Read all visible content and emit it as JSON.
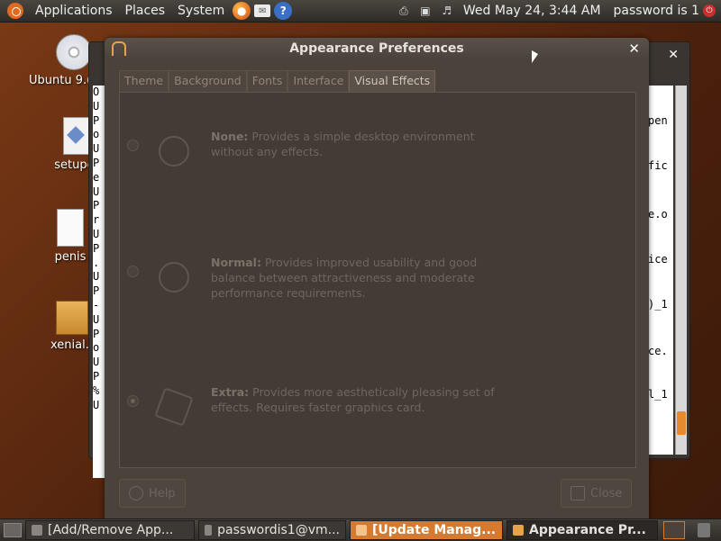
{
  "top_panel": {
    "menus": [
      "Applications",
      "Places",
      "System"
    ],
    "launchers": [
      "firefox-icon",
      "mail-icon",
      "help-icon"
    ],
    "clock": "Wed May 24,  3:44 AM",
    "user": "password is 1"
  },
  "desktop_icons": [
    {
      "label": "Ubuntu 9.(",
      "icon": "cd-icon"
    },
    {
      "label": "setupce",
      "icon": "script-icon"
    },
    {
      "label": "penis",
      "icon": "text-file-icon"
    },
    {
      "label": "xenial.t",
      "icon": "archive-icon"
    }
  ],
  "terminal": {
    "left_text": "O\nU\nP\no\nU\nP\ne\nU\nP\nr\nU\nP\n.\nU\nP\n-\nU\nP\no\nU\nP\n%\nU",
    "right_fragments": [
      "pen",
      "fic",
      "e.o",
      "ice",
      ")_1",
      "ce.",
      "l_1"
    ]
  },
  "dialog": {
    "title": "Appearance Preferences",
    "tabs": [
      "Theme",
      "Background",
      "Fonts",
      "Interface",
      "Visual Effects"
    ],
    "active_tab": "Visual Effects",
    "options": [
      {
        "title": "None:",
        "text": "Provides a simple desktop environment without any effects.",
        "selected": false
      },
      {
        "title": "Normal:",
        "text": "Provides improved usability and good balance between attractiveness and moderate performance requirements.",
        "selected": false
      },
      {
        "title": "Extra:",
        "text": "Provides more aesthetically pleasing set of effects. Requires faster graphics card.",
        "selected": true
      }
    ],
    "help_label": "Help",
    "close_label": "Close"
  },
  "taskbar": {
    "items": [
      {
        "label": "[Add/Remove App...",
        "state": "normal"
      },
      {
        "label": "passwordis1@vm...",
        "state": "normal"
      },
      {
        "label": "[Update Manag...",
        "state": "active"
      },
      {
        "label": "Appearance Pr...",
        "state": "focus"
      }
    ]
  }
}
